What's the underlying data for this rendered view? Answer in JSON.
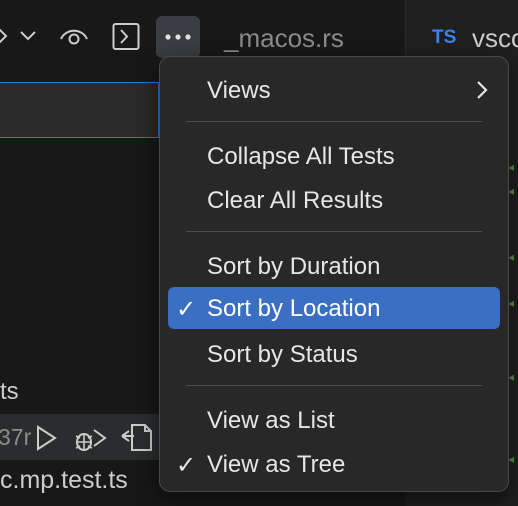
{
  "toolbar": {
    "icons": [
      "chevron-right-icon",
      "chevron-down-icon",
      "eye-icon",
      "terminal-icon",
      "more-icon"
    ]
  },
  "tabs": [
    {
      "label": "_macos.rs"
    },
    {
      "badge": "TS",
      "label": "vsco"
    }
  ],
  "side_panel": {
    "section_label": "ts",
    "row_duration": "37r",
    "file_name": "c.mp.test.ts"
  },
  "menu": {
    "items": [
      {
        "label": "Views",
        "has_submenu": true,
        "checked": false,
        "selected": false
      },
      {
        "label": "Collapse All Tests",
        "checked": false,
        "selected": false
      },
      {
        "label": "Clear All Results",
        "checked": false,
        "selected": false
      },
      {
        "label": "Sort by Duration",
        "checked": false,
        "selected": false
      },
      {
        "label": "Sort by Location",
        "checked": true,
        "selected": true
      },
      {
        "label": "Sort by Status",
        "checked": false,
        "selected": false
      },
      {
        "label": "View as List",
        "checked": false,
        "selected": false
      },
      {
        "label": "View as Tree",
        "checked": true,
        "selected": false
      }
    ],
    "check_glyph": "✓",
    "selected_color": "#3a6fc4"
  }
}
